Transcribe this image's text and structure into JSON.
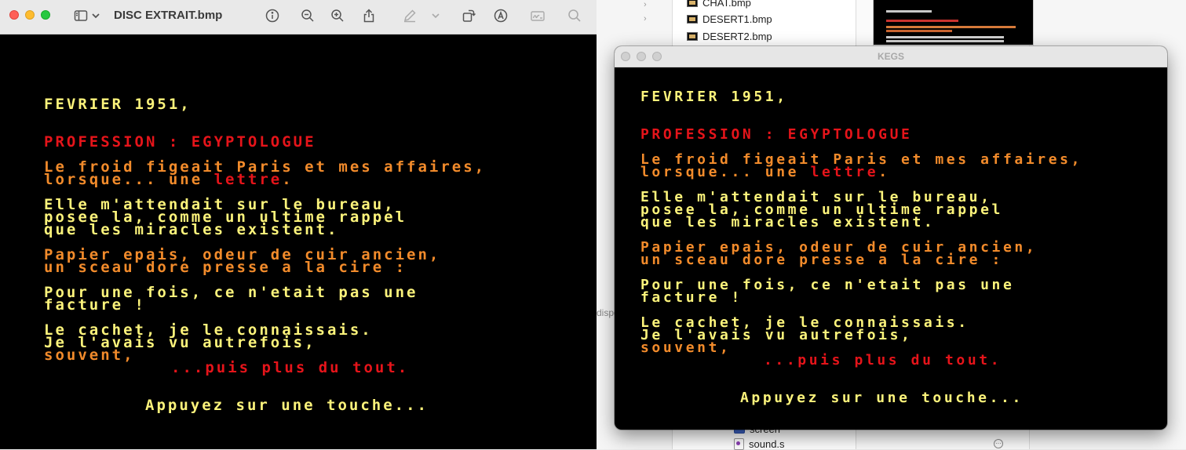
{
  "preview": {
    "window_title": "DISC EXTRAIT.bmp"
  },
  "kegs": {
    "window_title": "KEGS"
  },
  "finder": {
    "files": [
      "CHAT.bmp",
      "DESERT1.bmp",
      "DESERT2.bmp"
    ],
    "bottom_files": [
      "screen",
      "sound.s"
    ],
    "partial_label": "dispo"
  },
  "screen_text": {
    "date": "FEVRIER 1951,",
    "profession": "PROFESSION : EGYPTOLOGUE",
    "p1_l1": "Le froid figeait Paris et mes affaires,",
    "p1_l2_a": "lorsque... une ",
    "p1_l2_b": "lettre",
    "p1_l2_c": ".",
    "p2_l1": "Elle m'attendait sur le bureau,",
    "p2_l2": "posee la, comme un ultime rappel",
    "p2_l3": "que les miracles existent.",
    "p3_l1": "Papier epais, odeur de cuir ancien,",
    "p3_l2": "un sceau dore presse a la cire :",
    "p4_l1": "Pour une fois, ce n'etait pas une",
    "p4_l2": "facture !",
    "p5_l1": "Le cachet, je le connaissais.",
    "p5_l2": "Je l'avais vu autrefois,",
    "p5_l3": "souvent,",
    "p5_l4": "...puis plus du tout.",
    "prompt": "Appuyez sur une touche..."
  },
  "colors": {
    "apple_yellow": "#fcf37b",
    "apple_red": "#e5141a",
    "apple_orange": "#f28b2b"
  }
}
